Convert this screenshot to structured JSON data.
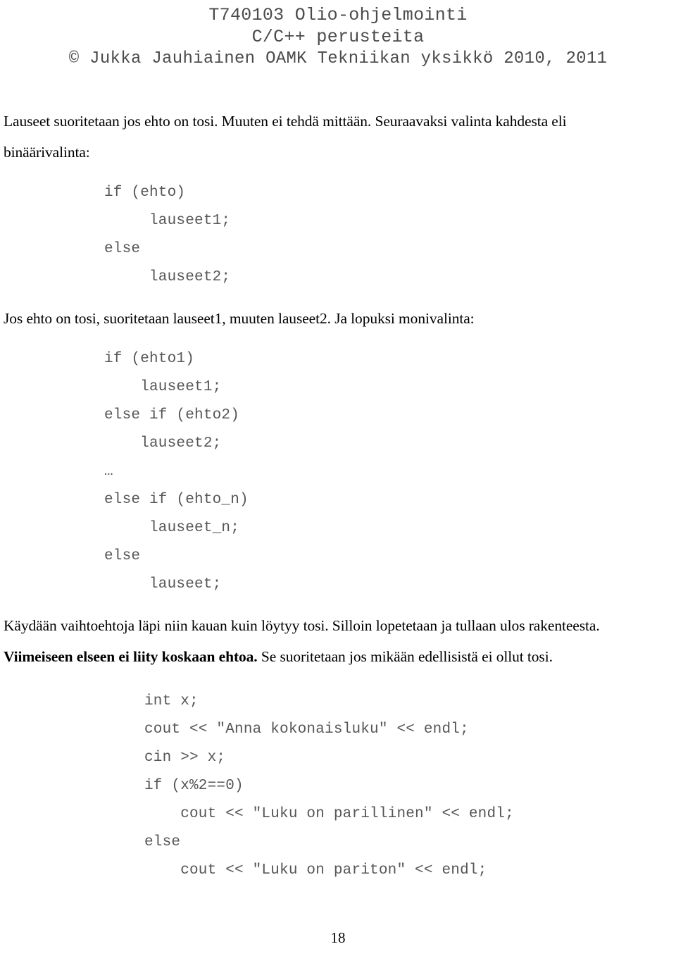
{
  "header": {
    "line1": "T740103 Olio-ohjelmointi",
    "line2": "C/C++ perusteita",
    "line3": "© Jukka Jauhiainen OAMK Tekniikan yksikkö 2010, 2011"
  },
  "body": {
    "para1": "Lauseet suoritetaan jos ehto on tosi. Muuten ei tehdä mittään. Seuraavaksi valinta kahdesta eli binäärivalinta:",
    "code1": "if (ehto)\n     lauseet1;\nelse\n     lauseet2;",
    "para2": "Jos ehto on tosi, suoritetaan lauseet1, muuten lauseet2. Ja lopuksi monivalinta:",
    "code2": "if (ehto1)\n    lauseet1;\nelse if (ehto2)\n    lauseet2;\n…\nelse if (ehto_n)\n     lauseet_n;\nelse\n     lauseet;",
    "para3": "Käydään vaihtoehtoja läpi niin kauan kuin löytyy tosi. Silloin lopetetaan ja tullaan ulos rakenteesta.",
    "para4_bold": "Viimeiseen elseen ei liity koskaan ehtoa.",
    "para4_rest": " Se suoritetaan jos mikään edellisistä ei ollut tosi.",
    "code3": "int x;\ncout << \"Anna kokonaisluku\" << endl;\ncin >> x;\nif (x%2==0)\n    cout << \"Luku on parillinen\" << endl;\nelse\n    cout << \"Luku on pariton\" << endl;"
  },
  "footer": {
    "page_number": "18"
  },
  "colors": {
    "text": "#000000",
    "code": "#565656",
    "header": "#4b4b4b",
    "background": "#ffffff"
  }
}
